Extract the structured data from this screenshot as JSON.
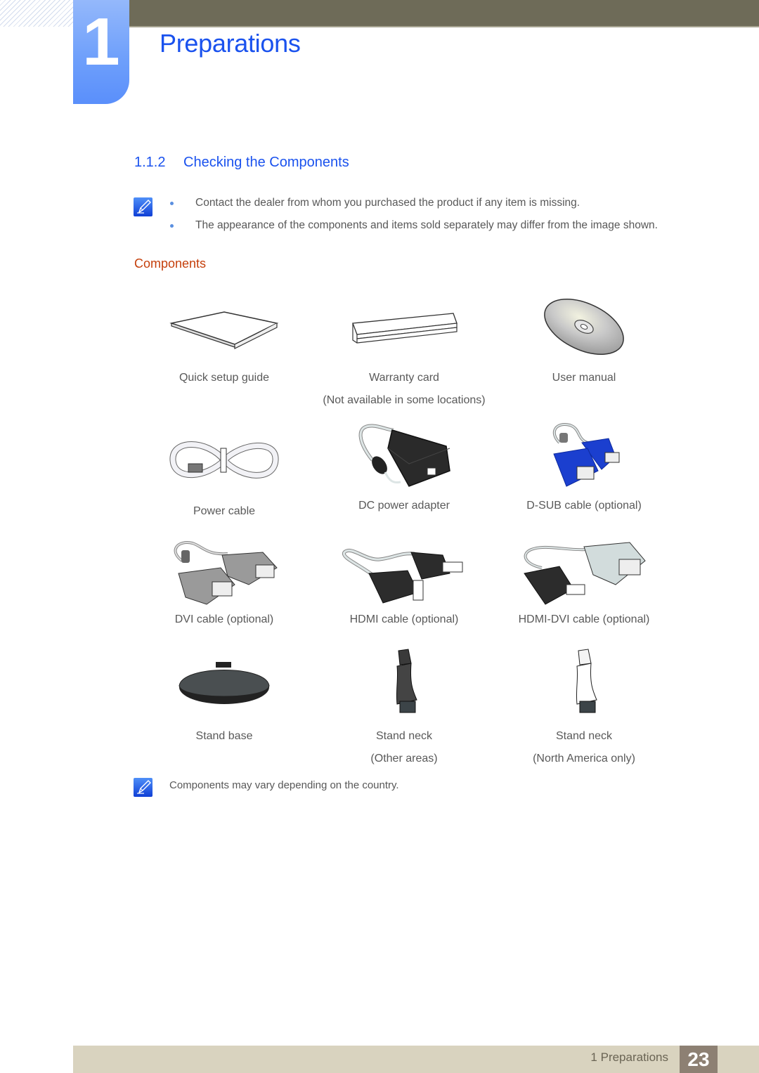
{
  "chapter": {
    "number": "1",
    "title": "Preparations"
  },
  "section": {
    "number": "1.1.2",
    "title": "Checking the Components"
  },
  "notes": {
    "top_bullets": [
      "Contact the dealer from whom you purchased the product if any item is missing.",
      "The appearance of the components and items sold separately may differ from the image shown."
    ],
    "bottom": "Components may vary depending on the country."
  },
  "subheading": "Components",
  "components": [
    {
      "label": "Quick setup guide",
      "sublabel": "",
      "icon": "booklet-icon"
    },
    {
      "label": "Warranty card",
      "sublabel": "(Not available in some locations)",
      "icon": "card-icon"
    },
    {
      "label": "User manual",
      "sublabel": "",
      "icon": "cd-icon"
    },
    {
      "label": "Power cable",
      "sublabel": "",
      "icon": "power-cable-icon"
    },
    {
      "label": "DC power adapter",
      "sublabel": "",
      "icon": "power-adapter-icon"
    },
    {
      "label": "D-SUB cable (optional)",
      "sublabel": "",
      "icon": "dsub-cable-icon"
    },
    {
      "label": "DVI cable (optional)",
      "sublabel": "",
      "icon": "dvi-cable-icon"
    },
    {
      "label": "HDMI cable (optional)",
      "sublabel": "",
      "icon": "hdmi-cable-icon"
    },
    {
      "label": "HDMI-DVI cable (optional)",
      "sublabel": "",
      "icon": "hdmi-dvi-cable-icon"
    },
    {
      "label": "Stand base",
      "sublabel": "",
      "icon": "stand-base-icon"
    },
    {
      "label": "Stand neck",
      "sublabel": "(Other areas)",
      "icon": "stand-neck-dark-icon"
    },
    {
      "label": "Stand neck",
      "sublabel": "(North America only)",
      "icon": "stand-neck-white-icon"
    }
  ],
  "footer": {
    "chapter_label": "1 Preparations",
    "page_number": "23"
  },
  "colors": {
    "accent_blue": "#1a52ee",
    "subheading_orange": "#c5400c",
    "header_bar": "#6e6b58",
    "footer_bar": "#d9d3bf",
    "page_box": "#8d8073"
  }
}
